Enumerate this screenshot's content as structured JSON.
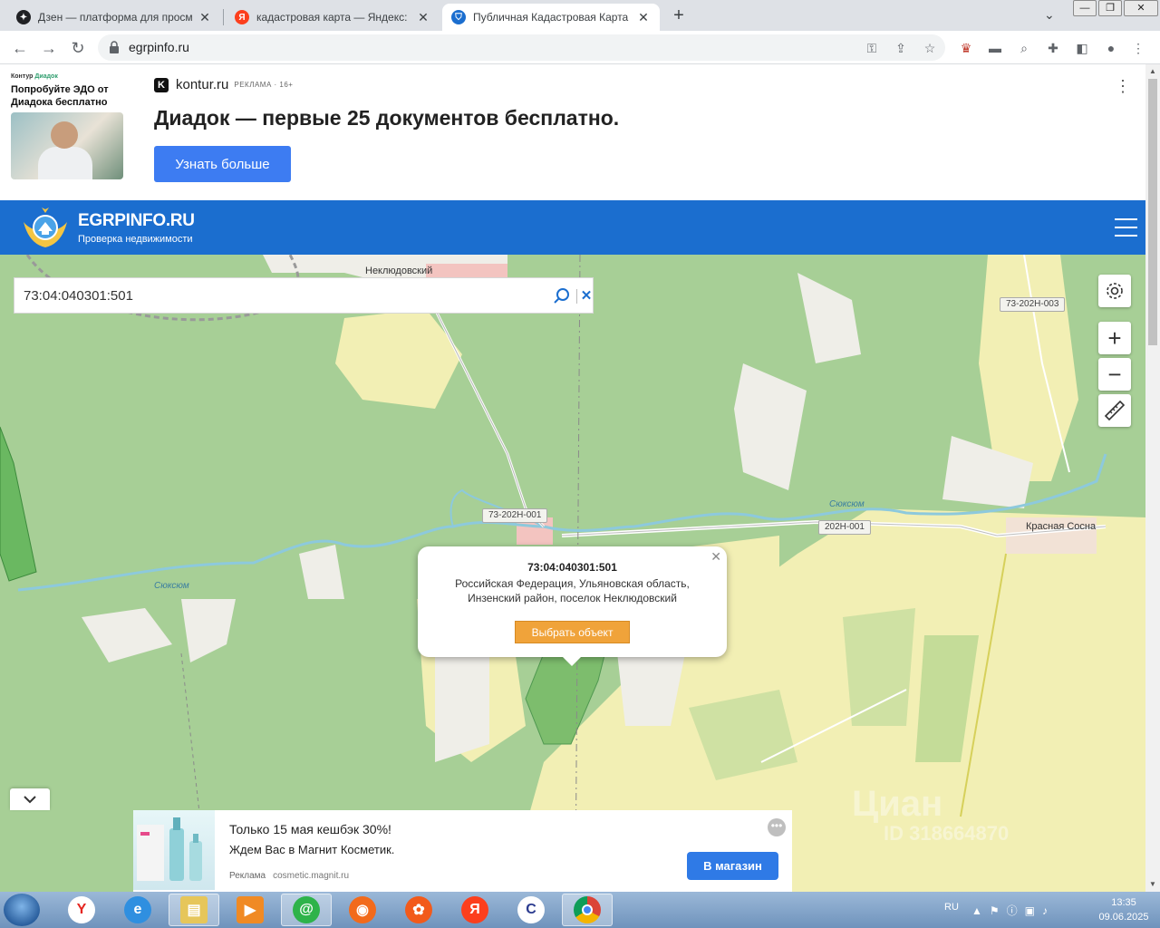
{
  "browser": {
    "tabs": [
      {
        "label": "Дзен — платформа для просм",
        "favicon": "dzen-icon"
      },
      {
        "label": "кадастровая карта — Яндекс: на",
        "favicon": "yandex-icon"
      },
      {
        "label": "Публичная Кадастровая Карта Р",
        "favicon": "shield-icon",
        "active": true
      }
    ],
    "url": "egrpinfo.ru"
  },
  "ad_top": {
    "brand": "Контур",
    "brand_accent": "Диадок",
    "headline": "Попробуйте ЭДО от Диадока бесплатно",
    "domain": "kontur.ru",
    "tag": "РЕКЛАМА · 16+",
    "title": "Диадок — первые 25 документов бесплатно.",
    "button": "Узнать больше"
  },
  "site": {
    "name": "EGRPINFO.RU",
    "subtitle": "Проверка недвижимости"
  },
  "map": {
    "search": {
      "value": "73:04:040301:501"
    },
    "labels": {
      "village1": "Неклюдовский",
      "village2": "Красная Сосна",
      "river1": "Сюксюм",
      "river2": "Сюксюм"
    },
    "roads": [
      "73-202Н-003",
      "73-202Н-001",
      "202Н-001"
    ],
    "popup": {
      "title": "73:04:040301:501",
      "address": "Российская Федерация, Ульяновская область, Инзенский район, поселок Неклюдовский",
      "button": "Выбрать объект"
    },
    "watermark": "Циан",
    "watermark_id": "ID 318664870"
  },
  "ad_bottom": {
    "line1": "Только 15 мая кешбэк 30%!",
    "line2": "Ждем Вас в Магнит Косметик.",
    "label": "Реклама",
    "domain": "cosmetic.magnit.ru",
    "button": "В магазин"
  },
  "taskbar": {
    "lang": "RU",
    "time": "13:35",
    "date": "09.06.2025"
  },
  "colors": {
    "header_blue": "#1b6ecf",
    "forest": "#a7cf96",
    "field": "#f3f0b3",
    "popup_button": "#f0a33a",
    "ad_button": "#3d7cf2"
  }
}
